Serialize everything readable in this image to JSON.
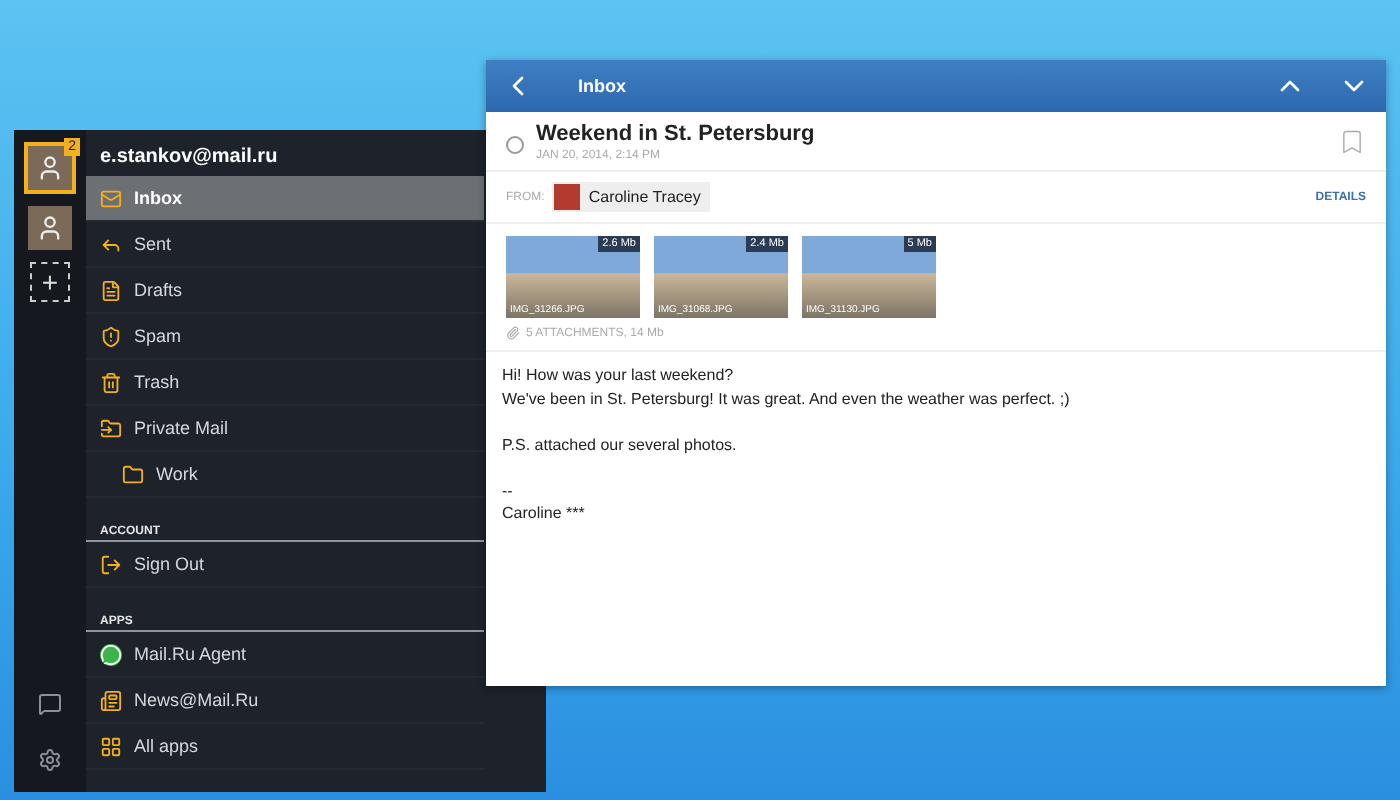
{
  "accounts": {
    "badge": "2",
    "add_label": "+"
  },
  "menu": {
    "email": "e.stankov@mail.ru",
    "folders": [
      {
        "label": "Inbox",
        "selected": true
      },
      {
        "label": "Sent",
        "selected": false
      },
      {
        "label": "Drafts",
        "selected": false
      },
      {
        "label": "Spam",
        "selected": false
      },
      {
        "label": "Trash",
        "selected": false
      },
      {
        "label": "Private Mail",
        "selected": false,
        "children": [
          {
            "label": "Work",
            "selected": false
          }
        ]
      }
    ],
    "sections": [
      {
        "title": "ACCOUNT",
        "items": [
          {
            "label": "Sign Out",
            "kind": "signout"
          }
        ]
      },
      {
        "title": "APPS",
        "items": [
          {
            "label": "Mail.Ru Agent",
            "kind": "agent"
          },
          {
            "label": "News@Mail.Ru",
            "kind": "news"
          },
          {
            "label": "All apps",
            "kind": "apps"
          }
        ]
      }
    ]
  },
  "message": {
    "toolbar_title": "Inbox",
    "subject": "Weekend in St. Petersburg",
    "date": "JAN 20, 2014, 2:14 PM",
    "read": false,
    "bookmarked": false,
    "from_label": "FROM:",
    "sender": "Caroline Tracey",
    "details": "DETAILS",
    "attachments": [
      {
        "size": "2.6 Mb",
        "name": "IMG_31266.JPG"
      },
      {
        "size": "2.4 Mb",
        "name": "IMG_31068.JPG"
      },
      {
        "size": "5 Mb",
        "name": "IMG_31130.JPG"
      }
    ],
    "attachments_summary": "5 ATTACHMENTS, 14 Mb",
    "body": [
      [
        "Hi! How was your last weekend?",
        "We've been in St. Petersburg! It was great. And even the weather was perfect. ;)"
      ],
      [
        "P.S. attached our several photos."
      ],
      [
        "--",
        "Caroline ***"
      ]
    ]
  }
}
